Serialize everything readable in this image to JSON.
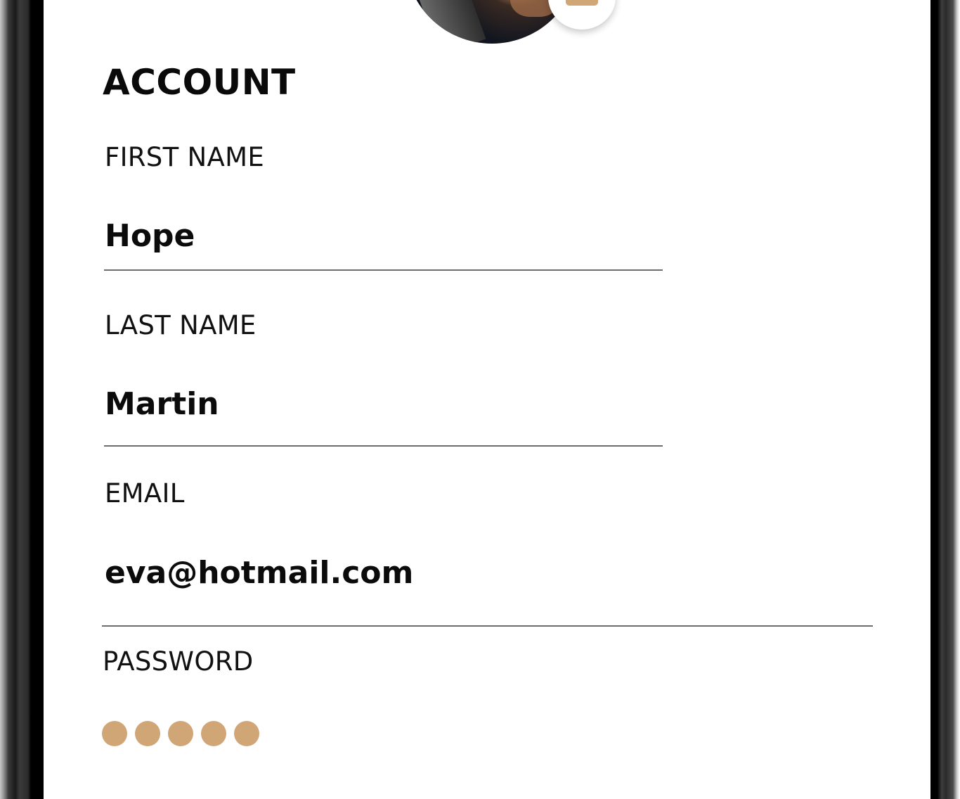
{
  "account": {
    "title": "ACCOUNT",
    "fields": {
      "first_name": {
        "label": "FIRST NAME",
        "value": "Hope"
      },
      "last_name": {
        "label": "LAST NAME",
        "value": "Martin"
      },
      "email": {
        "label": "EMAIL",
        "value": "eva@hotmail.com"
      },
      "password": {
        "label": "PASSWORD",
        "masked_length": 5
      }
    }
  },
  "colors": {
    "accent": "#d1a676",
    "text": "#0b0b0b",
    "divider": "#6d6d6d",
    "background": "#ffffff"
  },
  "icons": {
    "camera": "camera-icon"
  }
}
